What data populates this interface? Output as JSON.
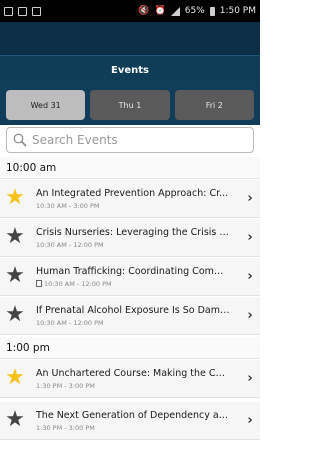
{
  "status_bar": {
    "battery": "65%",
    "time": "1:50 PM"
  },
  "header": {
    "title": "Events"
  },
  "days": [
    {
      "label": "Wed 31",
      "active": true
    },
    {
      "label": "Thu 1",
      "active": false
    },
    {
      "label": "Fri 2",
      "active": false
    }
  ],
  "search": {
    "placeholder": "Search Events"
  },
  "sections": [
    {
      "label": "10:00 am"
    },
    {
      "label": "1:00 pm"
    }
  ],
  "events": [
    {
      "title": "An Integrated Prevention Approach: Cr...",
      "time": "10:30 AM - 3:00 PM",
      "starred": true
    },
    {
      "title": "Crisis Nurseries: Leveraging the Crisis to...",
      "time": "10:30 AM - 12:00 PM",
      "starred": false
    },
    {
      "title": "Human Trafficking: Coordinating Commu...",
      "time": "10:30 AM - 12:00 PM",
      "starred": false,
      "has_note": true
    },
    {
      "title": "If Prenatal Alcohol Exposure Is So Dama...",
      "time": "10:30 AM - 12:00 PM",
      "starred": false
    },
    {
      "title": "An Unchartered Course: Making the Con...",
      "time": "1:30 PM - 3:00 PM",
      "starred": true
    },
    {
      "title": "The Next Generation of Dependency and...",
      "time": "1:30 PM - 3:00 PM",
      "starred": false
    }
  ],
  "colors": {
    "star_on": "#f6c21a",
    "star_off": "#444444",
    "header_bg": "#0f3c57"
  }
}
